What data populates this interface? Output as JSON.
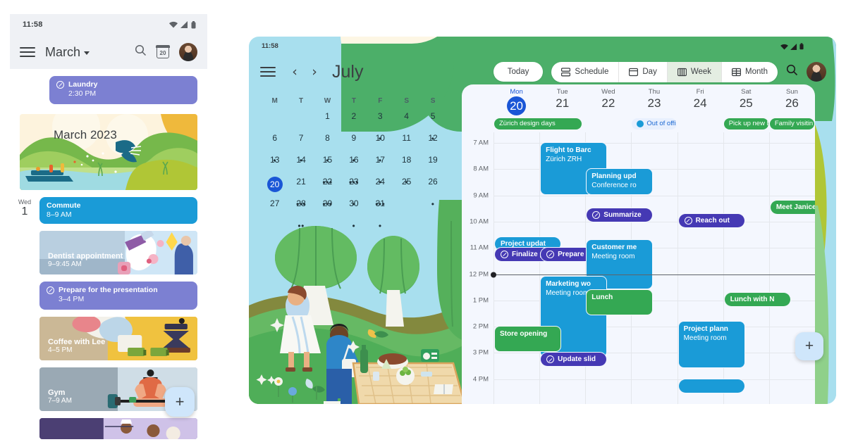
{
  "phone": {
    "status": {
      "time": "11:58",
      "icons": [
        "wifi-icon",
        "signal-icon",
        "battery-icon"
      ]
    },
    "appbar": {
      "menu_icon": "hamburger-menu-icon",
      "month_label": "March",
      "search_icon": "search-icon",
      "today_icon_label": "20",
      "avatar": "user-avatar"
    },
    "laundry": {
      "title": "Laundry",
      "time": "2:30 PM",
      "color": "#7c80d2"
    },
    "hero": {
      "title": "March 2023"
    },
    "rows": [
      {
        "dow": "Wed",
        "day": "1",
        "title": "Commute",
        "time": "8–9 AM",
        "kind": "chip",
        "color": "#1a9bd7"
      },
      {
        "title": "Dentist appointment",
        "time": "9–9:45 AM",
        "kind": "image",
        "theme": "dentist"
      },
      {
        "title": "Prepare for the presentation",
        "time": "3–4 PM",
        "kind": "task",
        "color": "#7c80d2"
      },
      {
        "title": "Coffee with Lee",
        "time": "4–5 PM",
        "kind": "image",
        "theme": "coffee"
      },
      {
        "title": "Gym",
        "time": "7–9 AM",
        "kind": "image",
        "theme": "gym"
      }
    ],
    "fab": "+"
  },
  "tablet": {
    "status": {
      "time": "11:58",
      "icons": [
        "wifi-icon",
        "signal-icon",
        "battery-icon"
      ]
    },
    "topbar": {
      "menu_icon": "hamburger-menu-icon",
      "prev_icon": "‹",
      "next_icon": "›",
      "month_label": "July",
      "today_label": "Today",
      "views": [
        {
          "label": "Schedule",
          "icon": "schedule-icon",
          "active": false
        },
        {
          "label": "Day",
          "icon": "day-icon",
          "active": false
        },
        {
          "label": "Week",
          "icon": "week-icon",
          "active": true
        },
        {
          "label": "Month",
          "icon": "month-icon",
          "active": false
        }
      ],
      "search_icon": "search-icon",
      "avatar": "user-avatar"
    },
    "mini_calendar": {
      "dow": [
        "M",
        "T",
        "W",
        "T",
        "F",
        "S",
        "S"
      ],
      "weeks": [
        [
          {
            "d": ""
          },
          {
            "d": ""
          },
          {
            "d": "1"
          },
          {
            "d": "2"
          },
          {
            "d": "3",
            "dots": 1
          },
          {
            "d": "4"
          },
          {
            "d": "5",
            "dots": 1
          }
        ],
        [
          {
            "d": "6",
            "dots": 1
          },
          {
            "d": "7",
            "dots": 1
          },
          {
            "d": "8",
            "dots": 1
          },
          {
            "d": "9",
            "dots": 1
          },
          {
            "d": "10",
            "dots": 1
          },
          {
            "d": "11"
          },
          {
            "d": "12"
          }
        ],
        [
          {
            "d": "13"
          },
          {
            "d": "14"
          },
          {
            "d": "15",
            "dots": 3
          },
          {
            "d": "16",
            "dots": 3
          },
          {
            "d": "17",
            "dots": 1
          },
          {
            "d": "18",
            "dots": 1
          },
          {
            "d": "19"
          }
        ],
        [
          {
            "d": "20",
            "selected": true
          },
          {
            "d": "21",
            "dots": 3
          },
          {
            "d": "22",
            "dots": 3
          },
          {
            "d": "23",
            "dots": 1
          },
          {
            "d": "24",
            "dots": 3
          },
          {
            "d": "25"
          },
          {
            "d": "26",
            "dots": 1
          }
        ],
        [
          {
            "d": "27"
          },
          {
            "d": "28",
            "dots": 2
          },
          {
            "d": "29"
          },
          {
            "d": "30",
            "dots": 1
          },
          {
            "d": "31",
            "dots": 1
          },
          {
            "d": ""
          },
          {
            "d": ""
          }
        ]
      ]
    },
    "week": {
      "days": [
        {
          "dow": "Mon",
          "num": "20",
          "today": true
        },
        {
          "dow": "Tue",
          "num": "21"
        },
        {
          "dow": "Wed",
          "num": "22"
        },
        {
          "dow": "Thu",
          "num": "23"
        },
        {
          "dow": "Fri",
          "num": "24"
        },
        {
          "dow": "Sat",
          "num": "25"
        },
        {
          "dow": "Sun",
          "num": "26"
        }
      ],
      "allday": [
        {
          "col": 0,
          "label": "Zürich design days",
          "color": "#34a853",
          "span": 1
        },
        {
          "col": 3,
          "label": "Out of offi",
          "kind": "ooo"
        },
        {
          "col": 5,
          "label": "Pick up new b",
          "color": "#34a853"
        },
        {
          "col": 6,
          "label": "Family visitin",
          "color": "#34a853"
        }
      ],
      "hours": [
        "7 AM",
        "8 AM",
        "9 AM",
        "10 AM",
        "11 AM",
        "12 PM",
        "1 PM",
        "2 PM",
        "3 PM",
        "4 PM"
      ],
      "now_label": "12 PM",
      "events": [
        {
          "col": 1,
          "start": 7.0,
          "end": 9.0,
          "title": "Flight to Barc",
          "sub": "Zürich ZRH",
          "color": "#1a9bd7"
        },
        {
          "col": 2,
          "start": 8.0,
          "end": 9.0,
          "title": "Planning upd",
          "sub": "Conference ro",
          "color": "#1a9bd7"
        },
        {
          "col": 2,
          "start": 9.5,
          "end": 10.0,
          "title": "Summarize",
          "kind": "task",
          "color": "#4539b4"
        },
        {
          "col": 0,
          "start": 10.6,
          "end": 11.0,
          "title": "Project updat",
          "kind": "pill",
          "color": "#1a9bd7"
        },
        {
          "col": 0,
          "start": 11.0,
          "end": 11.5,
          "title": "Finalize pr",
          "kind": "task",
          "color": "#4539b4"
        },
        {
          "col": 1,
          "start": 11.0,
          "end": 11.5,
          "title": "Prepare we",
          "kind": "task",
          "color": "#4539b4"
        },
        {
          "col": 2,
          "start": 10.7,
          "end": 12.6,
          "title": "Customer me",
          "sub": "Meeting room",
          "color": "#1a9bd7"
        },
        {
          "col": 1,
          "start": 12.1,
          "end": 15.2,
          "title": "Marketing wo",
          "sub": "Meeting room",
          "color": "#1a9bd7"
        },
        {
          "col": 2,
          "start": 12.6,
          "end": 13.6,
          "title": "Lunch",
          "color": "#34a853"
        },
        {
          "col": 0,
          "start": 14.0,
          "end": 15.0,
          "title": "Store opening",
          "kind": "block",
          "color": "#34a853"
        },
        {
          "col": 1,
          "start": 15.0,
          "end": 15.5,
          "title": "Update slid",
          "kind": "task",
          "color": "#4539b4"
        },
        {
          "col": 4,
          "start": 9.7,
          "end": 10.2,
          "title": "Reach out",
          "kind": "task",
          "color": "#4539b4"
        },
        {
          "col": 6,
          "start": 9.2,
          "end": 9.7,
          "title": "Meet Janice",
          "kind": "pill",
          "color": "#34a853"
        },
        {
          "col": 5,
          "start": 12.7,
          "end": 13.2,
          "title": "Lunch with N",
          "kind": "pill",
          "color": "#34a853"
        },
        {
          "col": 4,
          "start": 13.8,
          "end": 15.6,
          "title": "Project plann",
          "sub": "Meeting room",
          "color": "#1a9bd7"
        },
        {
          "col": 4,
          "start": 16.0,
          "end": 16.4,
          "title": "",
          "kind": "pill",
          "color": "#1a9bd7"
        }
      ]
    },
    "fab": "+"
  },
  "colors": {
    "blue_event": "#1a9bd7",
    "green_event": "#34a853",
    "purple_task": "#4539b4",
    "lavender": "#7c80d2",
    "today_blue": "#1a56d6",
    "header_green": "#4caf69",
    "sky": "#a8dfee",
    "panel_bg": "#f4f7fe"
  }
}
